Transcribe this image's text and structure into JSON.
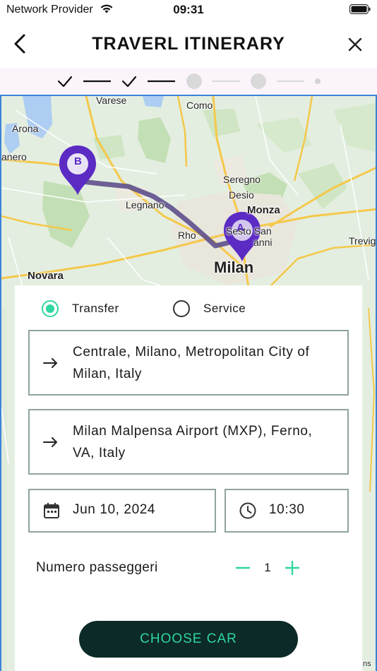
{
  "status_bar": {
    "carrier": "Network Provider",
    "time": "09:31"
  },
  "header": {
    "title": "TRAVERL ITINERARY",
    "back_icon": "chevron-left-icon",
    "close_icon": "close-icon"
  },
  "stepper": {
    "steps_total": 5,
    "steps_completed": 2
  },
  "map": {
    "labels": [
      "Varese",
      "Como",
      "Arona",
      "anero",
      "Seregno",
      "Desio",
      "Legnano",
      "Monza",
      "Sesto San",
      "anni",
      "Rho",
      "Trevig",
      "Novara",
      "Milan",
      "ns"
    ],
    "marker_a": "A",
    "marker_b": "B",
    "route_color": "#5e4f8c",
    "marker_color": "#5b2bc4"
  },
  "form": {
    "mode_options": [
      {
        "label": "Transfer",
        "selected": true
      },
      {
        "label": "Service",
        "selected": false
      }
    ],
    "origin": "Centrale, Milano, Metropolitan City of Milan, Italy",
    "destination": "Milan Malpensa Airport (MXP), Ferno, VA, Italy",
    "date": "Jun 10, 2024",
    "time": "10:30",
    "passengers_label": "Numero passeggeri",
    "passengers_count": "1",
    "cta_label": "CHOOSE CAR"
  },
  "colors": {
    "accent": "#2fd6a0",
    "button_bg": "#0c2a27",
    "field_border": "#8fa49b"
  }
}
